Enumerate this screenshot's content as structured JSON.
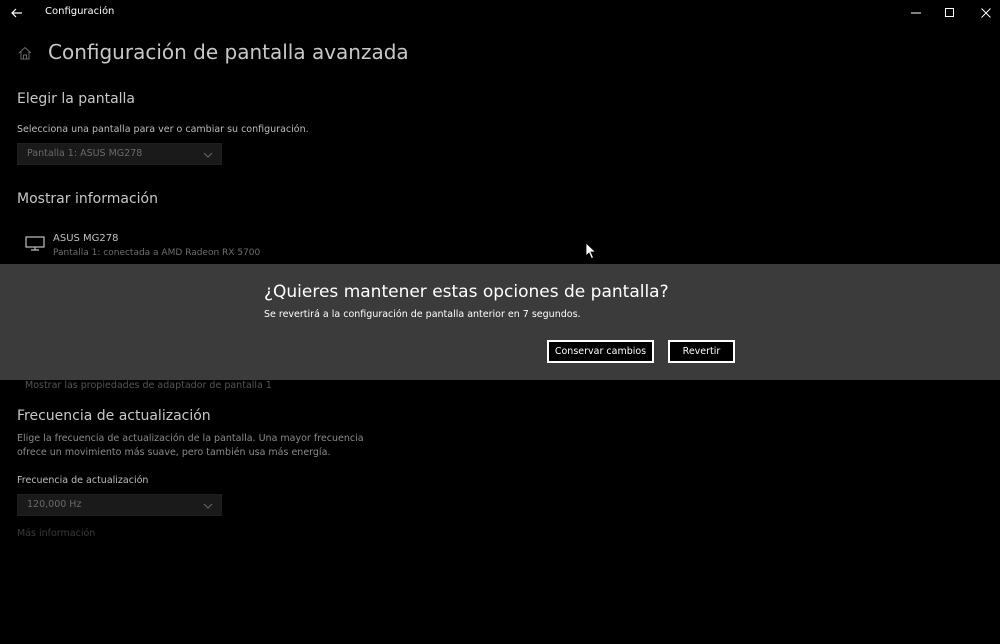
{
  "window": {
    "title": "Configuración",
    "back_icon": "back-arrow-icon",
    "controls": [
      "minimize-icon",
      "maximize-icon",
      "close-icon"
    ]
  },
  "page": {
    "title": "Configuración de pantalla avanzada",
    "home_icon": "home-icon"
  },
  "choose_display": {
    "heading": "Elegir la pantalla",
    "description": "Selecciona una pantalla para ver o cambiar su configuración.",
    "selected": "Pantalla 1: ASUS MG278"
  },
  "display_info": {
    "heading": "Mostrar información",
    "monitor_name": "ASUS MG278",
    "monitor_detail": "Pantalla 1: conectada a AMD Radeon RX 5700",
    "adapter_link": "Mostrar las propiedades de adaptador de pantalla 1"
  },
  "refresh": {
    "heading": "Frecuencia de actualización",
    "description_line1": "Elige la frecuencia de actualización de la pantalla. Una mayor frecuencia",
    "description_line2": "ofrece un movimiento más suave, pero también usa más energía.",
    "label": "Frecuencia de actualización",
    "selected": "120,000 Hz",
    "more_info": "Más información"
  },
  "dialog": {
    "title": "¿Quieres mantener estas opciones de pantalla?",
    "message": "Se revertirá a la configuración de pantalla anterior en  7 segundos.",
    "keep_button": "Conservar cambios",
    "revert_button": "Revertir"
  },
  "colors": {
    "background": "#000000",
    "dialog_background": "#3b3b3b",
    "text": "#ffffff"
  }
}
